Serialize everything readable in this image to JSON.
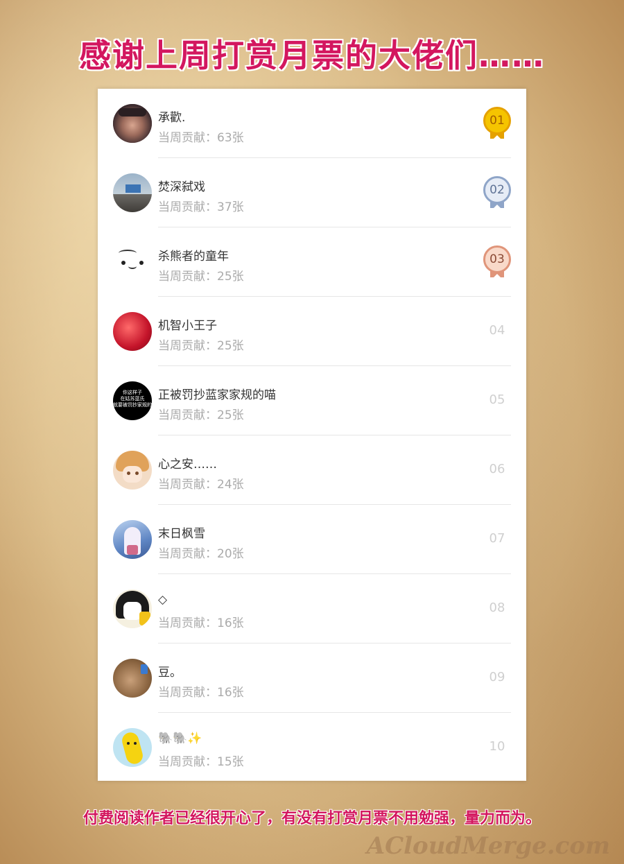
{
  "header": {
    "title": "感谢上周打赏月票的大佬们……"
  },
  "contrib_label": "当周贡献：",
  "list": [
    {
      "name": "承歡.",
      "contribution": "63张",
      "rank": "01",
      "medal": "gold"
    },
    {
      "name": "焚深弑戏",
      "contribution": "37张",
      "rank": "02",
      "medal": "silver"
    },
    {
      "name": "杀熊者的童年",
      "contribution": "25张",
      "rank": "03",
      "medal": "bronze"
    },
    {
      "name": "机智小王子",
      "contribution": "25张",
      "rank": "04",
      "medal": "none"
    },
    {
      "name": "正被罚抄蓝家家规的喵",
      "contribution": "25张",
      "rank": "05",
      "medal": "none"
    },
    {
      "name": "心之安……",
      "contribution": "24张",
      "rank": "06",
      "medal": "none"
    },
    {
      "name": "末日枫雪",
      "contribution": "20张",
      "rank": "07",
      "medal": "none"
    },
    {
      "name": "◇",
      "contribution": "16张",
      "rank": "08",
      "medal": "none"
    },
    {
      "name": "豆。",
      "contribution": "16张",
      "rank": "09",
      "medal": "none"
    },
    {
      "name": "🐘🐘✨",
      "contribution": "15张",
      "rank": "10",
      "medal": "none"
    }
  ],
  "avatar5_text": [
    "你这样子",
    "在姑苏蓝氏",
    "就要被罚抄家规的"
  ],
  "colors": {
    "accent": "#d3175f",
    "gold": "#e5a100",
    "silver": "#8fa5c8",
    "bronze": "#e0957a"
  },
  "footer": {
    "text": "付费阅读作者已经很开心了，有没有打赏月票不用勉强，量力而为。"
  },
  "watermark": {
    "text": "ACloudMerge.com"
  }
}
